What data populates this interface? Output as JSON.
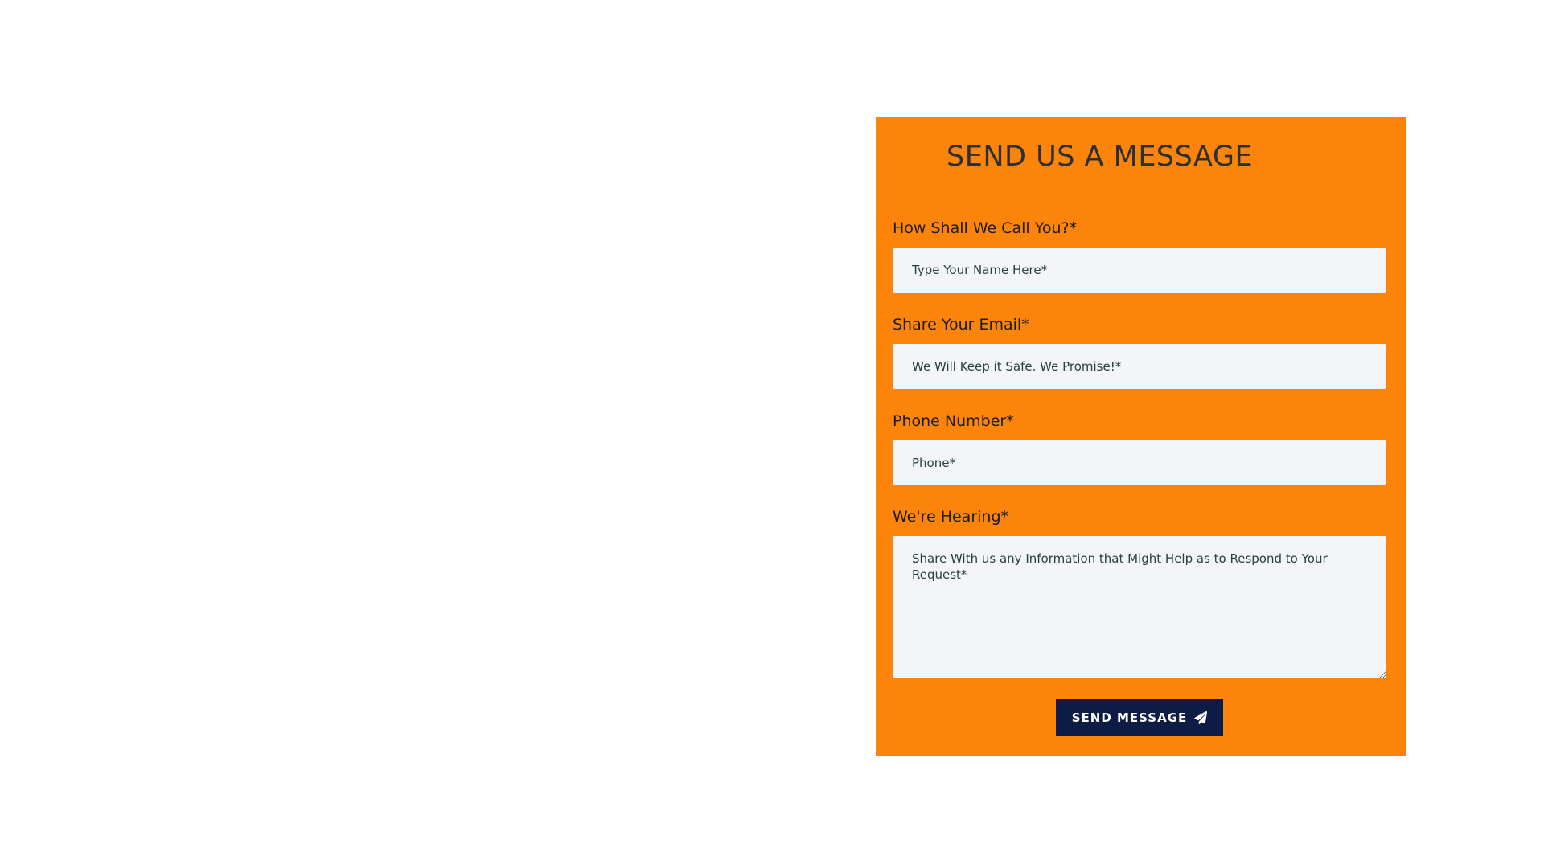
{
  "contact_form": {
    "title": "SEND US A MESSAGE",
    "name_field": {
      "label": "How Shall We Call You?*",
      "placeholder": "Type Your Name Here*"
    },
    "email_field": {
      "label": "Share Your Email*",
      "placeholder": "We Will Keep it Safe. We Promise!*"
    },
    "phone_field": {
      "label": "Phone Number*",
      "placeholder": "Phone*"
    },
    "message_field": {
      "label": "We're Hearing*",
      "placeholder": "Share With us any Information that Might Help as to Respond to Your Request*"
    },
    "submit_button": {
      "label": "SEND MESSAGE",
      "icon": "paper-plane-icon"
    }
  },
  "colors": {
    "panel_background": "#fd840a",
    "input_background": "#f4f5f7",
    "button_background": "#0c1c44",
    "title_text": "#2c2f33",
    "page_background": "#ffffff"
  }
}
